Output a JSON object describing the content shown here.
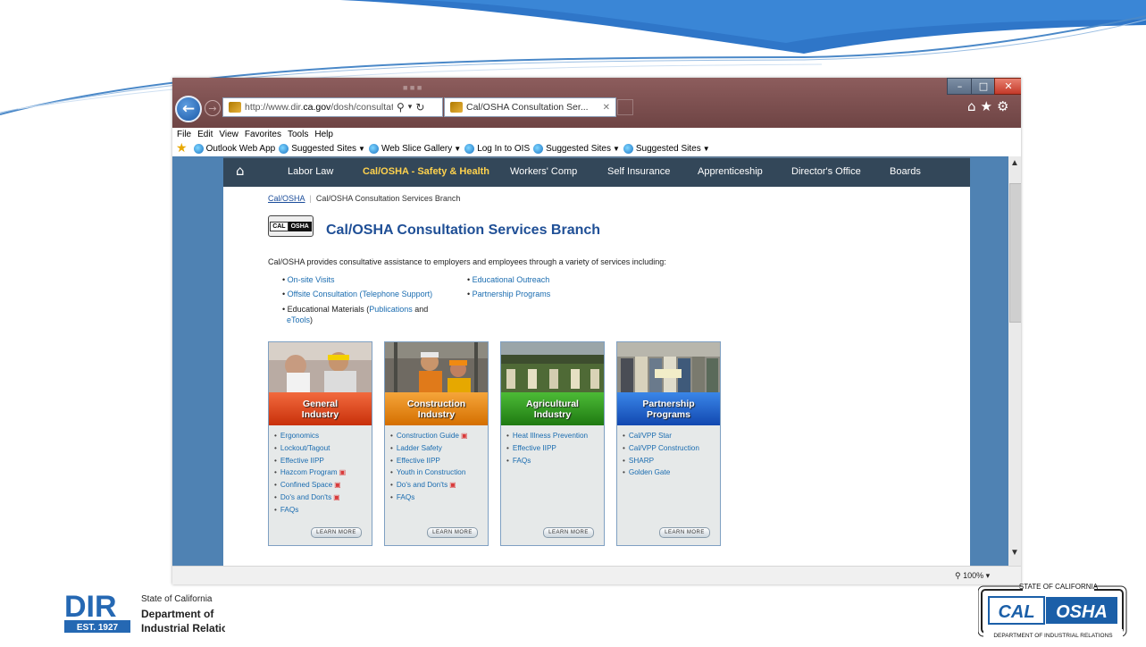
{
  "colors": {
    "swoosh_blue": "#2f76c8",
    "titlebar": "#7b4d4d",
    "nav_bg": "#334759",
    "nav_active": "#ffd24d",
    "page_frame": "#4f82b3",
    "link": "#1a6cb0",
    "title_blue": "#1f4f96"
  },
  "browser": {
    "address_url_prefix": "http://www.dir.",
    "address_url_domain": "ca.gov",
    "address_url_suffix": "/dosh/consultatio",
    "tab_title": "Cal/OSHA Consultation Ser...",
    "icons": [
      "back-arrow-icon",
      "forward-arrow-icon",
      "search-icon",
      "refresh-icon",
      "home-icon",
      "star-icon",
      "gear-icon"
    ],
    "window_buttons": [
      "minimize",
      "maximize",
      "close"
    ],
    "menu": [
      "File",
      "Edit",
      "View",
      "Favorites",
      "Tools",
      "Help"
    ],
    "favorites": [
      "Outlook Web App",
      "Suggested Sites",
      "Web Slice Gallery",
      "Log In to OIS",
      "Suggested Sites",
      "Suggested Sites"
    ],
    "zoom": "100%"
  },
  "nav": {
    "items": [
      "Labor Law",
      "Cal/OSHA - Safety & Health",
      "Workers' Comp",
      "Self Insurance",
      "Apprenticeship",
      "Director's Office",
      "Boards"
    ],
    "active": "Cal/OSHA - Safety & Health"
  },
  "breadcrumb": {
    "link": "Cal/OSHA",
    "current": "Cal/OSHA Consultation Services Branch"
  },
  "logo": {
    "cal": "CAL",
    "osha": "OSHA"
  },
  "page": {
    "title": "Cal/OSHA Consultation Services Branch",
    "intro": "Cal/OSHA provides consultative assistance to employers and employees through a variety of services including:",
    "services_left": {
      "onsite": "On-site Visits",
      "offsite": "Offsite Consultation (Telephone Support)",
      "materials_prefix": "Educational Materials (",
      "materials_link": "Publications",
      "materials_and": " and",
      "materials_link2": "eTools",
      "materials_close": ")"
    },
    "services_right": [
      "Educational Outreach",
      "Partnership Programs"
    ]
  },
  "cards": [
    {
      "line1": "General",
      "line2": "Industry",
      "color": "#e8431a",
      "items": [
        {
          "label": "Ergonomics",
          "pdf": false
        },
        {
          "label": "Lockout/Tagout",
          "pdf": false
        },
        {
          "label": "Effective IIPP",
          "pdf": false
        },
        {
          "label": "Hazcom Program",
          "pdf": true
        },
        {
          "label": "Confined Space",
          "pdf": true
        },
        {
          "label": "Do's and Don'ts",
          "pdf": true
        },
        {
          "label": "FAQs",
          "pdf": false
        }
      ],
      "learn": "LEARN MORE"
    },
    {
      "line1": "Construction",
      "line2": "Industry",
      "color": "#f08a12",
      "items": [
        {
          "label": "Construction Guide",
          "pdf": true
        },
        {
          "label": "Ladder Safety",
          "pdf": false
        },
        {
          "label": "Effective IIPP",
          "pdf": false
        },
        {
          "label": "Youth in Construction",
          "pdf": false
        },
        {
          "label": "Do's and Don'ts",
          "pdf": true
        },
        {
          "label": "FAQs",
          "pdf": false
        }
      ],
      "learn": "LEARN MORE"
    },
    {
      "line1": "Agricultural",
      "line2": "Industry",
      "color": "#2e9a1f",
      "items": [
        {
          "label": "Heat Illness Prevention",
          "pdf": false
        },
        {
          "label": "Effective IIPP",
          "pdf": false
        },
        {
          "label": "FAQs",
          "pdf": false
        }
      ],
      "learn": "LEARN MORE"
    },
    {
      "line1": "Partnership",
      "line2": "Programs",
      "color": "#1f5fd0",
      "items": [
        {
          "label": "Cal/VPP Star",
          "pdf": false
        },
        {
          "label": "Cal/VPP Construction",
          "pdf": false
        },
        {
          "label": "SHARP",
          "pdf": false
        },
        {
          "label": "Golden Gate",
          "pdf": false
        }
      ],
      "learn": "LEARN MORE"
    }
  ],
  "slide": {
    "dir_letters": "DIR",
    "dir_est": "EST. 1927",
    "dir_line1": "State of California",
    "dir_line2": "Department of",
    "dir_line3": "Industrial Relations",
    "cal_top": "STATE OF CALIFORNIA",
    "cal_left": "CAL",
    "cal_right": "OSHA",
    "cal_bottom": "DEPARTMENT OF INDUSTRIAL RELATIONS"
  }
}
